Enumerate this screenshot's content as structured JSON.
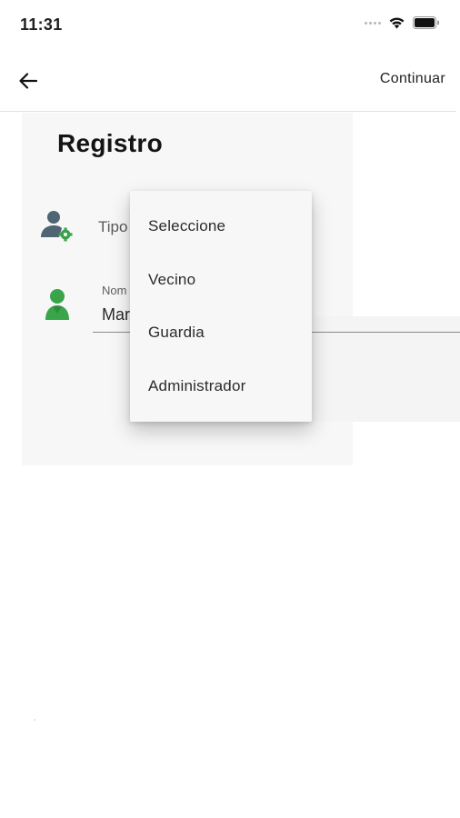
{
  "status_bar": {
    "time": "11:31"
  },
  "app_bar": {
    "action_label": "Continuar"
  },
  "page": {
    "title": "Registro"
  },
  "form": {
    "type_field": {
      "label_partial": "Tipo"
    },
    "name_field": {
      "label_partial": "Nom",
      "value_partial": "Mar"
    }
  },
  "dropdown": {
    "options": [
      "Seleccione",
      "Vecino",
      "Guardia",
      "Administrador"
    ]
  },
  "icons": {
    "back": "arrow-left-icon",
    "type": "user-gear-icon",
    "name": "user-icon"
  },
  "colors": {
    "accent_green": "#3aa44a",
    "icon_gray": "#4f6573"
  }
}
